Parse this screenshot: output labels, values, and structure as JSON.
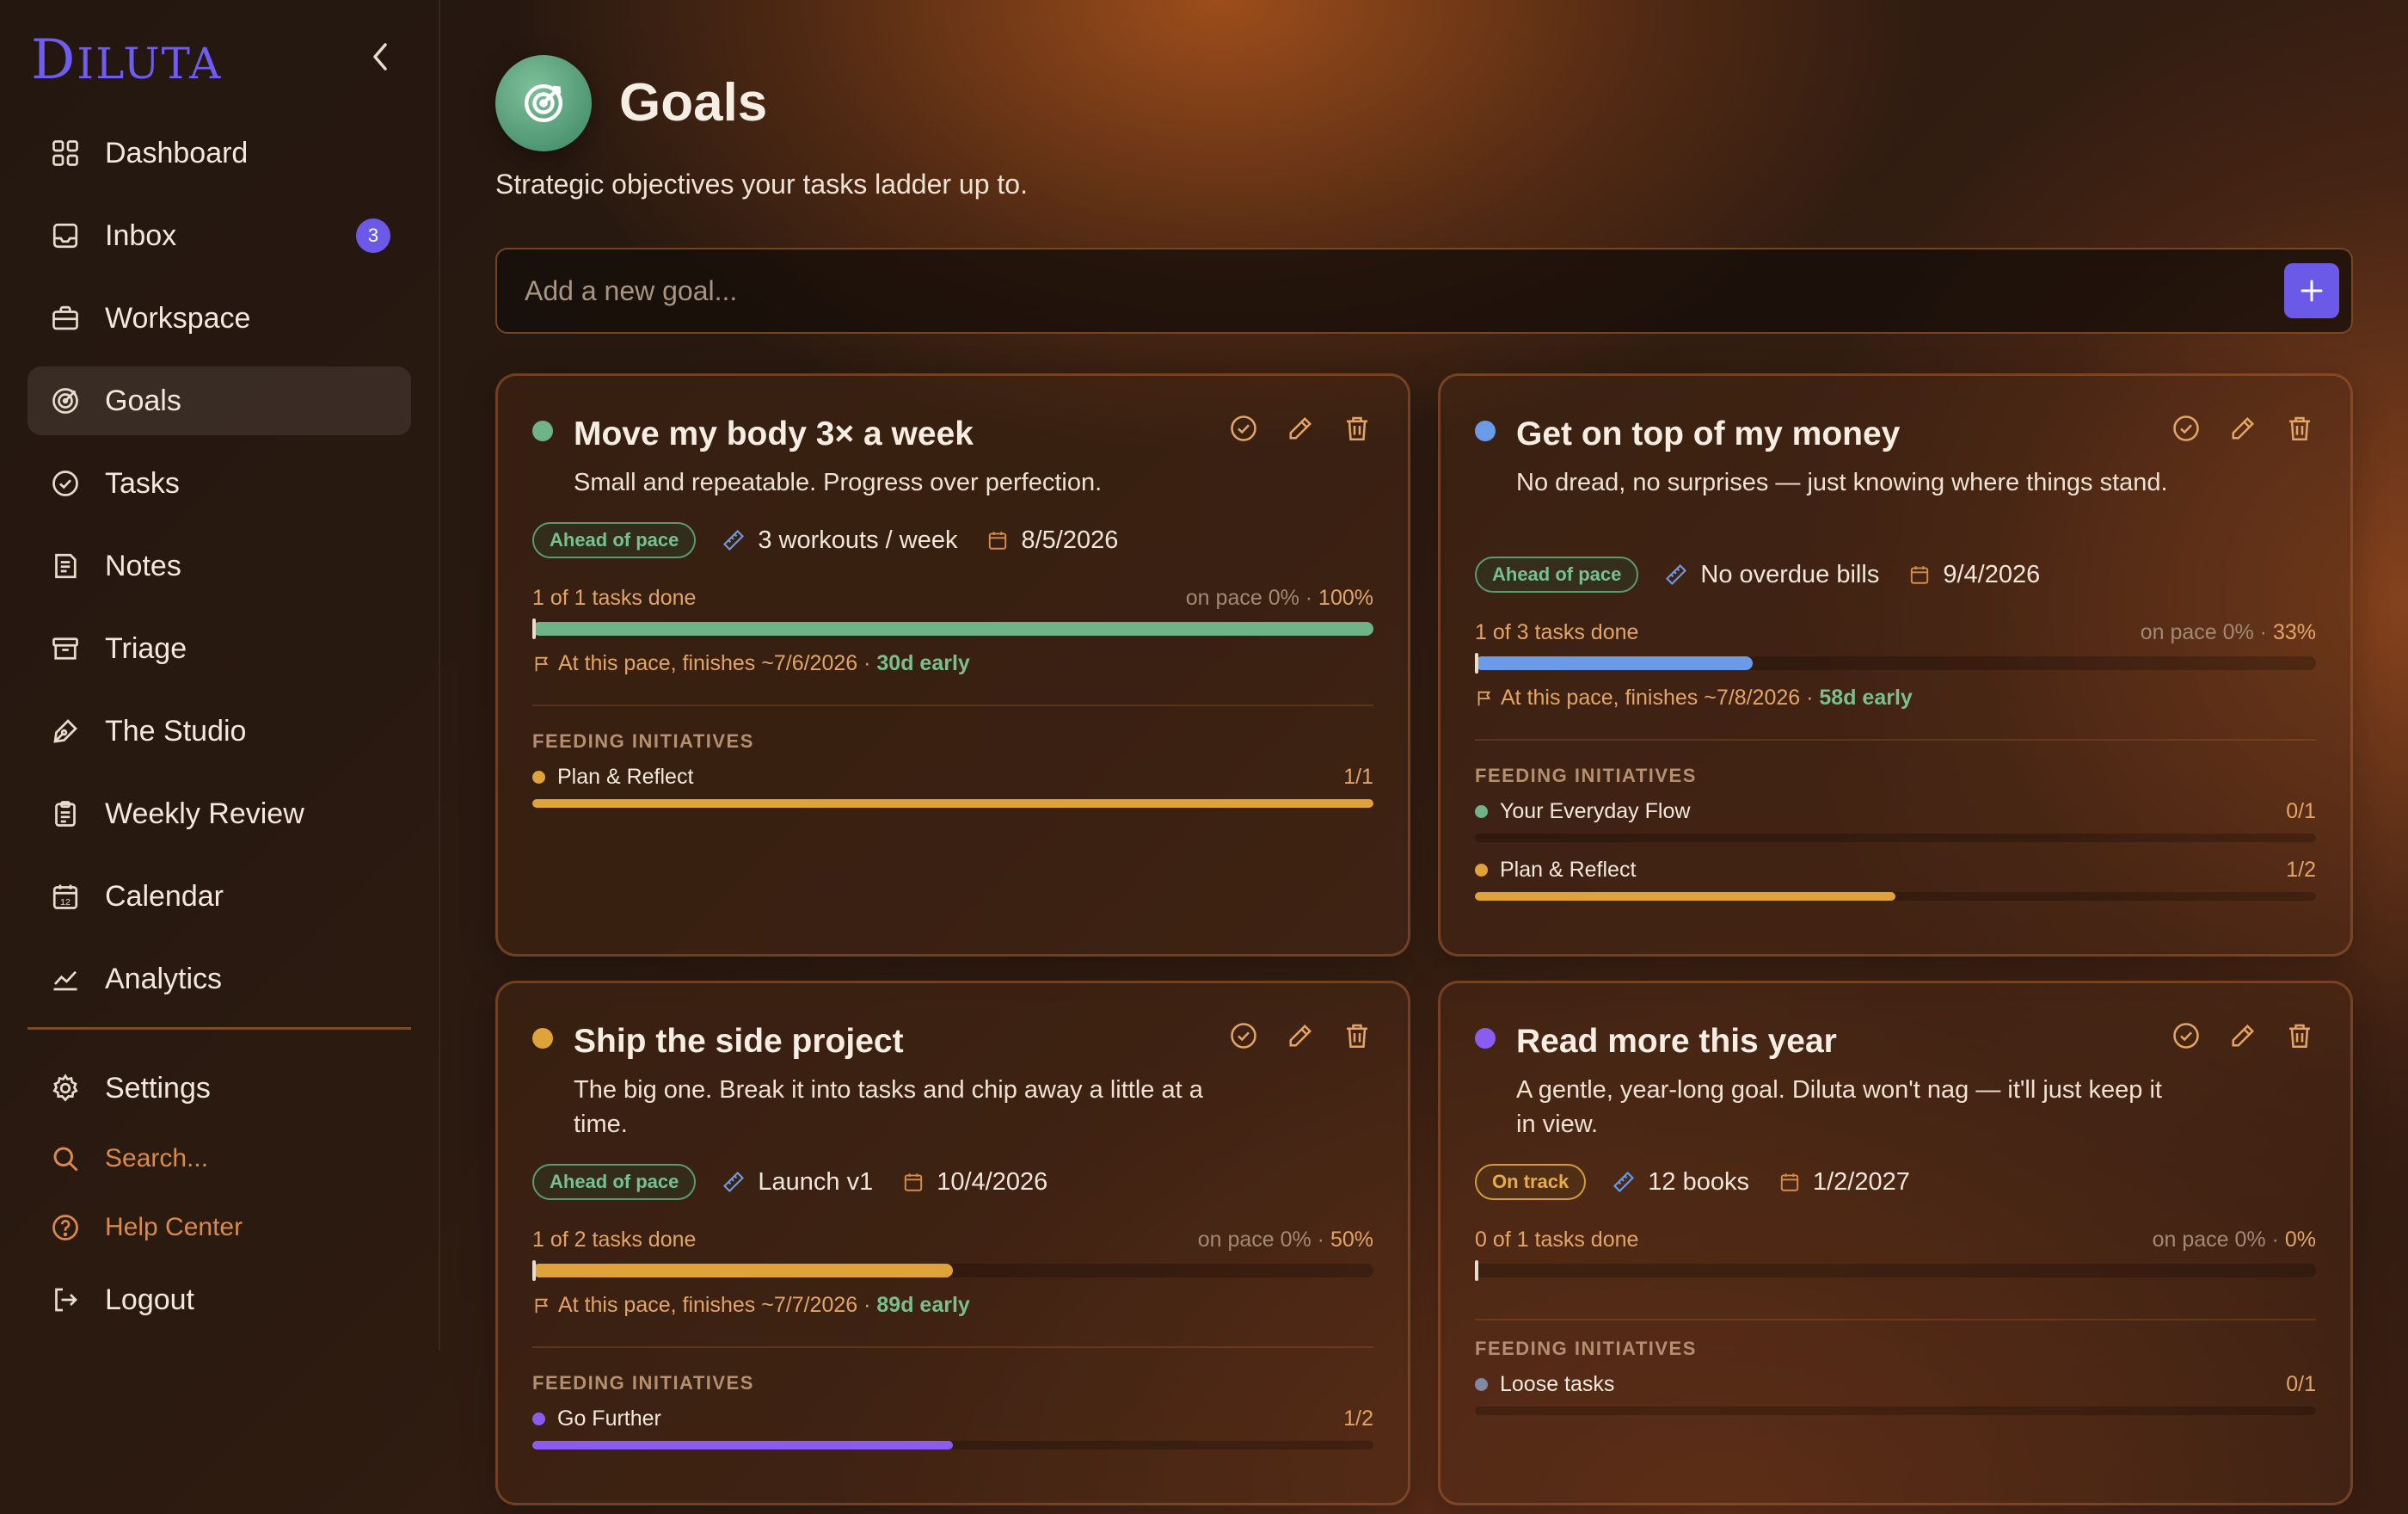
{
  "app": {
    "brand": "DILUTA",
    "brand_first": "D",
    "brand_rest": "ILUTA"
  },
  "sidebar": {
    "items": [
      {
        "label": "Dashboard",
        "icon": "dashboard-icon"
      },
      {
        "label": "Inbox",
        "icon": "inbox-icon",
        "badge": "3"
      },
      {
        "label": "Workspace",
        "icon": "briefcase-icon"
      },
      {
        "label": "Goals",
        "icon": "target-icon",
        "active": true
      },
      {
        "label": "Tasks",
        "icon": "check-circle-icon"
      },
      {
        "label": "Notes",
        "icon": "notes-icon"
      },
      {
        "label": "Triage",
        "icon": "archive-icon"
      },
      {
        "label": "The Studio",
        "icon": "pen-icon"
      },
      {
        "label": "Weekly Review",
        "icon": "clipboard-icon"
      },
      {
        "label": "Calendar",
        "icon": "calendar-icon"
      },
      {
        "label": "Analytics",
        "icon": "chart-icon"
      }
    ],
    "bottom": [
      {
        "label": "Settings",
        "icon": "gear-icon"
      },
      {
        "label": "Search...",
        "icon": "search-icon"
      },
      {
        "label": "Help Center",
        "icon": "help-icon"
      },
      {
        "label": "Logout",
        "icon": "logout-icon"
      }
    ]
  },
  "header": {
    "title": "Goals",
    "subtitle": "Strategic objectives your tasks ladder up to."
  },
  "add_goal": {
    "placeholder": "Add a new goal..."
  },
  "labels": {
    "feeding": "FEEDING INITIATIVES",
    "finish_prefix": "At this pace, finishes ~"
  },
  "colors": {
    "accent": "#6b5ae8",
    "green": "#6fb389",
    "blue": "#6b9be8",
    "amber": "#e0a33a",
    "purple": "#8a5cf0",
    "slate": "#7e8aa3"
  },
  "goals": [
    {
      "title": "Move my body 3× a week",
      "description": "Small and repeatable. Progress over perfection.",
      "dot_color": "#6fb389",
      "status": "Ahead of pace",
      "status_kind": "green",
      "target": "3 workouts / week",
      "due": "8/5/2026",
      "tasks_done": "1 of 1 tasks done",
      "on_pace": "on pace 0%",
      "percent_label": "100%",
      "progress": 1.0,
      "bar_color": "#6fb389",
      "finish_date": "7/6/2026",
      "early": "30d early",
      "initiatives": [
        {
          "name": "Plan & Reflect",
          "count": "1/1",
          "color": "#e0a33a",
          "progress": 1.0
        }
      ]
    },
    {
      "title": "Get on top of my money",
      "description": "No dread, no surprises — just knowing where things stand.",
      "dot_color": "#6b9be8",
      "status": "Ahead of pace",
      "status_kind": "green",
      "target": "No overdue bills",
      "due": "9/4/2026",
      "tasks_done": "1 of 3 tasks done",
      "on_pace": "on pace 0%",
      "percent_label": "33%",
      "progress": 0.33,
      "bar_color": "#6b9be8",
      "finish_date": "7/8/2026",
      "early": "58d early",
      "initiatives": [
        {
          "name": "Your Everyday Flow",
          "count": "0/1",
          "color": "#6fb389",
          "progress": 0
        },
        {
          "name": "Plan & Reflect",
          "count": "1/2",
          "color": "#e0a33a",
          "progress": 0.5
        }
      ]
    },
    {
      "title": "Ship the side project",
      "description": "The big one. Break it into tasks and chip away a little at a time.",
      "dot_color": "#e0a33a",
      "status": "Ahead of pace",
      "status_kind": "green",
      "target": "Launch v1",
      "due": "10/4/2026",
      "tasks_done": "1 of 2 tasks done",
      "on_pace": "on pace 0%",
      "percent_label": "50%",
      "progress": 0.5,
      "bar_color": "#e0a33a",
      "finish_date": "7/7/2026",
      "early": "89d early",
      "initiatives": [
        {
          "name": "Go Further",
          "count": "1/2",
          "color": "#8a5cf0",
          "progress": 0.5
        }
      ]
    },
    {
      "title": "Read more this year",
      "description": "A gentle, year-long goal. Diluta won't nag — it'll just keep it in view.",
      "dot_color": "#8a5cf0",
      "status": "On track",
      "status_kind": "amber",
      "target": "12 books",
      "due": "1/2/2027",
      "tasks_done": "0 of 1 tasks done",
      "on_pace": "on pace 0%",
      "percent_label": "0%",
      "progress": 0,
      "bar_color": "#8a5cf0",
      "finish_date": "",
      "early": "",
      "initiatives": [
        {
          "name": "Loose tasks",
          "count": "0/1",
          "color": "#7e8aa3",
          "progress": 0
        }
      ]
    }
  ]
}
